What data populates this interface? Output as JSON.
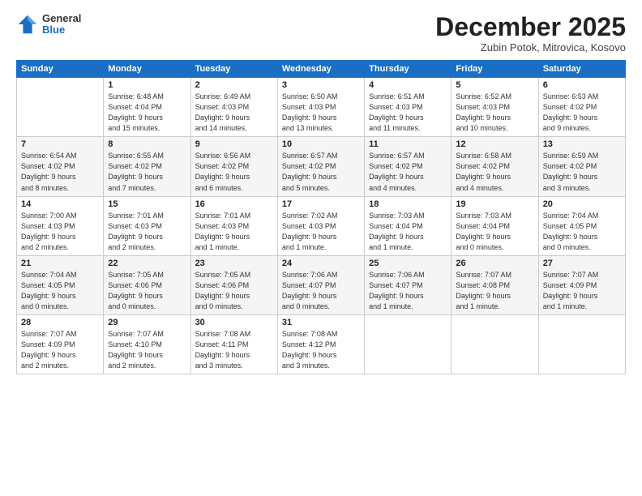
{
  "header": {
    "logo_general": "General",
    "logo_blue": "Blue",
    "month": "December 2025",
    "location": "Zubin Potok, Mitrovica, Kosovo"
  },
  "weekdays": [
    "Sunday",
    "Monday",
    "Tuesday",
    "Wednesday",
    "Thursday",
    "Friday",
    "Saturday"
  ],
  "weeks": [
    [
      {
        "day": "",
        "info": ""
      },
      {
        "day": "1",
        "info": "Sunrise: 6:48 AM\nSunset: 4:04 PM\nDaylight: 9 hours\nand 15 minutes."
      },
      {
        "day": "2",
        "info": "Sunrise: 6:49 AM\nSunset: 4:03 PM\nDaylight: 9 hours\nand 14 minutes."
      },
      {
        "day": "3",
        "info": "Sunrise: 6:50 AM\nSunset: 4:03 PM\nDaylight: 9 hours\nand 13 minutes."
      },
      {
        "day": "4",
        "info": "Sunrise: 6:51 AM\nSunset: 4:03 PM\nDaylight: 9 hours\nand 11 minutes."
      },
      {
        "day": "5",
        "info": "Sunrise: 6:52 AM\nSunset: 4:03 PM\nDaylight: 9 hours\nand 10 minutes."
      },
      {
        "day": "6",
        "info": "Sunrise: 6:53 AM\nSunset: 4:02 PM\nDaylight: 9 hours\nand 9 minutes."
      }
    ],
    [
      {
        "day": "7",
        "info": "Sunrise: 6:54 AM\nSunset: 4:02 PM\nDaylight: 9 hours\nand 8 minutes."
      },
      {
        "day": "8",
        "info": "Sunrise: 6:55 AM\nSunset: 4:02 PM\nDaylight: 9 hours\nand 7 minutes."
      },
      {
        "day": "9",
        "info": "Sunrise: 6:56 AM\nSunset: 4:02 PM\nDaylight: 9 hours\nand 6 minutes."
      },
      {
        "day": "10",
        "info": "Sunrise: 6:57 AM\nSunset: 4:02 PM\nDaylight: 9 hours\nand 5 minutes."
      },
      {
        "day": "11",
        "info": "Sunrise: 6:57 AM\nSunset: 4:02 PM\nDaylight: 9 hours\nand 4 minutes."
      },
      {
        "day": "12",
        "info": "Sunrise: 6:58 AM\nSunset: 4:02 PM\nDaylight: 9 hours\nand 4 minutes."
      },
      {
        "day": "13",
        "info": "Sunrise: 6:59 AM\nSunset: 4:02 PM\nDaylight: 9 hours\nand 3 minutes."
      }
    ],
    [
      {
        "day": "14",
        "info": "Sunrise: 7:00 AM\nSunset: 4:03 PM\nDaylight: 9 hours\nand 2 minutes."
      },
      {
        "day": "15",
        "info": "Sunrise: 7:01 AM\nSunset: 4:03 PM\nDaylight: 9 hours\nand 2 minutes."
      },
      {
        "day": "16",
        "info": "Sunrise: 7:01 AM\nSunset: 4:03 PM\nDaylight: 9 hours\nand 1 minute."
      },
      {
        "day": "17",
        "info": "Sunrise: 7:02 AM\nSunset: 4:03 PM\nDaylight: 9 hours\nand 1 minute."
      },
      {
        "day": "18",
        "info": "Sunrise: 7:03 AM\nSunset: 4:04 PM\nDaylight: 9 hours\nand 1 minute."
      },
      {
        "day": "19",
        "info": "Sunrise: 7:03 AM\nSunset: 4:04 PM\nDaylight: 9 hours\nand 0 minutes."
      },
      {
        "day": "20",
        "info": "Sunrise: 7:04 AM\nSunset: 4:05 PM\nDaylight: 9 hours\nand 0 minutes."
      }
    ],
    [
      {
        "day": "21",
        "info": "Sunrise: 7:04 AM\nSunset: 4:05 PM\nDaylight: 9 hours\nand 0 minutes."
      },
      {
        "day": "22",
        "info": "Sunrise: 7:05 AM\nSunset: 4:06 PM\nDaylight: 9 hours\nand 0 minutes."
      },
      {
        "day": "23",
        "info": "Sunrise: 7:05 AM\nSunset: 4:06 PM\nDaylight: 9 hours\nand 0 minutes."
      },
      {
        "day": "24",
        "info": "Sunrise: 7:06 AM\nSunset: 4:07 PM\nDaylight: 9 hours\nand 0 minutes."
      },
      {
        "day": "25",
        "info": "Sunrise: 7:06 AM\nSunset: 4:07 PM\nDaylight: 9 hours\nand 1 minute."
      },
      {
        "day": "26",
        "info": "Sunrise: 7:07 AM\nSunset: 4:08 PM\nDaylight: 9 hours\nand 1 minute."
      },
      {
        "day": "27",
        "info": "Sunrise: 7:07 AM\nSunset: 4:09 PM\nDaylight: 9 hours\nand 1 minute."
      }
    ],
    [
      {
        "day": "28",
        "info": "Sunrise: 7:07 AM\nSunset: 4:09 PM\nDaylight: 9 hours\nand 2 minutes."
      },
      {
        "day": "29",
        "info": "Sunrise: 7:07 AM\nSunset: 4:10 PM\nDaylight: 9 hours\nand 2 minutes."
      },
      {
        "day": "30",
        "info": "Sunrise: 7:08 AM\nSunset: 4:11 PM\nDaylight: 9 hours\nand 3 minutes."
      },
      {
        "day": "31",
        "info": "Sunrise: 7:08 AM\nSunset: 4:12 PM\nDaylight: 9 hours\nand 3 minutes."
      },
      {
        "day": "",
        "info": ""
      },
      {
        "day": "",
        "info": ""
      },
      {
        "day": "",
        "info": ""
      }
    ]
  ]
}
